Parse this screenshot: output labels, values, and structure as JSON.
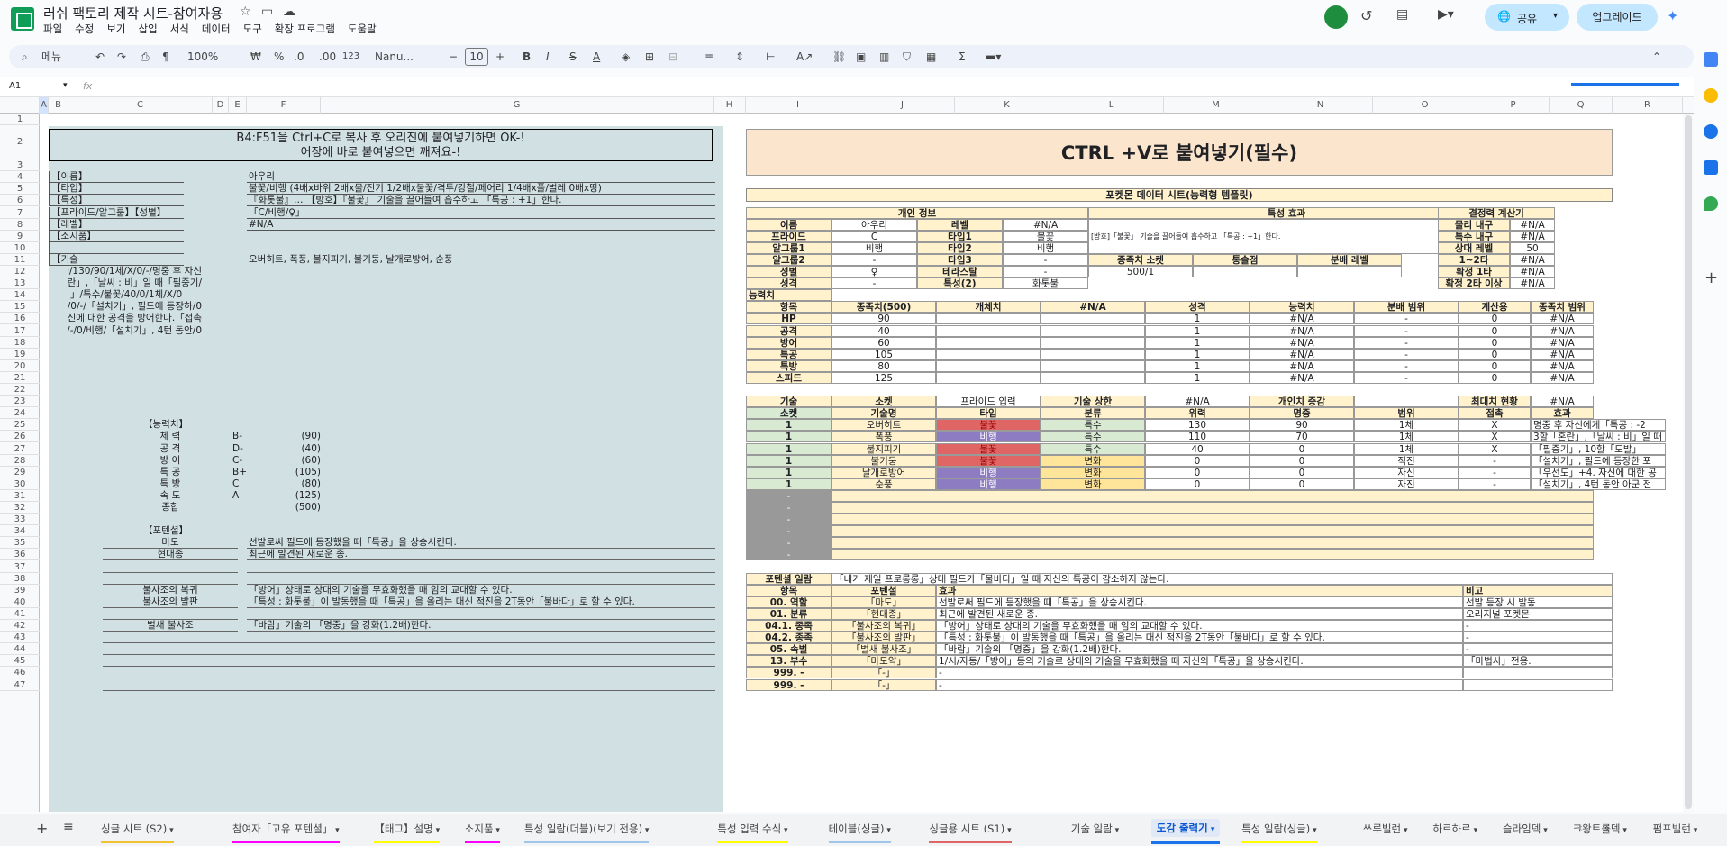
{
  "title": "러쉬 팩토리 제작 시트-참여자용",
  "menu": [
    "파일",
    "수정",
    "보기",
    "삽입",
    "서식",
    "데이터",
    "도구",
    "확장 프로그램",
    "도움말"
  ],
  "share": "공유",
  "upgrade": "업그레이드",
  "toolbar": {
    "search": "메뉴",
    "zoom": "100%",
    "currency": "₩",
    "percent": "%",
    "dec1": ".0",
    "dec2": ".00",
    "num": "123",
    "font": "Nanu...",
    "size": "10"
  },
  "namebox": "A1",
  "fx": "fx",
  "cols": [
    "A",
    "B",
    "C",
    "D",
    "E",
    "F",
    "G",
    "H",
    "I",
    "J",
    "K",
    "L",
    "M",
    "N",
    "O",
    "P",
    "Q",
    "R"
  ],
  "rows": [
    "1",
    "2",
    "3",
    "4",
    "5",
    "6",
    "7",
    "8",
    "9",
    "10",
    "11",
    "12",
    "13",
    "14",
    "15",
    "16",
    "17",
    "18",
    "19",
    "20",
    "21",
    "22",
    "23",
    "24",
    "25",
    "26",
    "27",
    "28",
    "29",
    "30",
    "31",
    "32",
    "33",
    "34",
    "35",
    "36",
    "37",
    "38",
    "39",
    "40",
    "41",
    "42",
    "43",
    "44",
    "45",
    "46",
    "47"
  ],
  "left": {
    "banner1": "B4:F51을 Ctrl+C로 복사 후 오리진에 붙여넣기하면 OK-!",
    "banner2": "어장에 바로 붙여넣으면 깨져요-!",
    "labels": [
      "【이름】",
      "【타입】",
      "【특성】",
      "【프라이드/알그룹】【성별】",
      "【레벨】",
      "【소지품】",
      "",
      "【기술"
    ],
    "name": "아우리",
    "type": "불꽃/비행       (4배x바위   2배x물/전기   1/2배x불꽃/격투/강철/페어리   1/4배x풀/벌레   0배x땅)",
    "trait": "『화톳불』…       【방호】『불꽃』 기술을 끌어들여 흡수하고 「특공 : +1」한다.",
    "pride": "「C/비행/♀」",
    "level": "#N/A",
    "skills_line": "오버히트, 폭풍, 불지피기, 불기둥, 날개로방어, 순풍",
    "skill_frags": [
      "꽃/130/90/1체/X/0/-/명중 후 자신!",
      "/3할「혼란」,「날씨 : 비」일 때「필중기",
      "특수/불꽃/40/0/1체/X/0/「",
      "0/적진/-/0/-/「설치기」, 필드에 등장하",
      "자신에 대한 공격을 방어한다.「접촉",
      "0/자진/-/0/비행/「설치기」, 4턴 동안"
    ],
    "ability_title": "【능력치】",
    "stats": [
      [
        "체   력",
        "B-",
        "(90)"
      ],
      [
        "공   격",
        "D-",
        "(40)"
      ],
      [
        "방   어",
        "C-",
        "(60)"
      ],
      [
        "특   공",
        "B+",
        "(105)"
      ],
      [
        "특   방",
        "C",
        "(80)"
      ],
      [
        "속   도",
        "A",
        "(125)"
      ],
      [
        "종합",
        "",
        "(500)"
      ]
    ],
    "potential_title": "【포텐셜】",
    "potentials": [
      [
        "마도",
        "선발로써 필드에 등장했을 때「특공」을 상승시킨다."
      ],
      [
        "현대종",
        "최근에 발견된 새로운 종."
      ],
      [
        "",
        ""
      ],
      [
        "",
        ""
      ],
      [
        "불사조의 복귀",
        "「방어」상태로 상대의 기술을 무효화했을 때 임의 교대할 수 있다."
      ],
      [
        "불사조의 발판",
        "「특성 : 화톳불」이 발동했을 때「특공」을 올리는 대신 적진을 2T동안「불바다」로 할 수 있다."
      ],
      [
        "",
        ""
      ],
      [
        "벌새 불사조",
        "「바람」기술의 「명중」을 강화(1.2배)한다."
      ]
    ]
  },
  "right": {
    "banner": "CTRL +V로 붙여넣기(필수)",
    "sheet_title": "포켓몬 데이터 시트(능력형 템플릿)",
    "sec_personal": "개인 정보",
    "sec_trait": "특성 효과",
    "sec_decide": "결정력 계산기",
    "info": [
      [
        "이름",
        "아우리",
        "레벨",
        "#N/A"
      ],
      [
        "프라이드",
        "C",
        "타입1",
        "불꽃"
      ],
      [
        "알그룹1",
        "비행",
        "타입2",
        "비행"
      ],
      [
        "알그룹2",
        "-",
        "타입3",
        "-"
      ],
      [
        "성별",
        "♀",
        "테라스탈",
        "-"
      ],
      [
        "성격",
        "-",
        "특성(2)",
        "화톳불"
      ]
    ],
    "trait_effect": "[방호]「불꽃」 기술을 끌어들여 흡수하고 「특공 : +1」한다.",
    "species_hdr": [
      "종족치 소켓",
      "통솔점",
      "분배 레벨"
    ],
    "species_val": "500/1",
    "calc": [
      [
        "물리 내구",
        "#N/A"
      ],
      [
        "특수 내구",
        "#N/A"
      ],
      [
        "상대 레벨",
        "50"
      ],
      [
        "1~2타",
        "#N/A"
      ],
      [
        "확정 1타",
        "#N/A"
      ],
      [
        "확정 2타 이상",
        "#N/A"
      ]
    ],
    "abil_label": "능력치",
    "stat_hdr": [
      "항목",
      "종족치(500)",
      "개체치",
      "#N/A",
      "성격",
      "능력치",
      "분배 범위",
      "계산용",
      "종족치 범위"
    ],
    "stats": [
      [
        "HP",
        "90",
        "1",
        "#N/A",
        "-",
        "0",
        "#N/A"
      ],
      [
        "공격",
        "40",
        "1",
        "#N/A",
        "-",
        "0",
        "#N/A"
      ],
      [
        "방어",
        "60",
        "1",
        "#N/A",
        "-",
        "0",
        "#N/A"
      ],
      [
        "특공",
        "105",
        "1",
        "#N/A",
        "-",
        "0",
        "#N/A"
      ],
      [
        "특방",
        "80",
        "1",
        "#N/A",
        "-",
        "0",
        "#N/A"
      ],
      [
        "스피드",
        "125",
        "1",
        "#N/A",
        "-",
        "0",
        "#N/A"
      ]
    ],
    "skill_top": [
      "기술",
      "소켓",
      "프라이드 입력",
      "기술 상한",
      "#N/A",
      "개인치 증감",
      "",
      "최대치 현황",
      "#N/A"
    ],
    "skill_hdr": [
      "소켓",
      "기술명",
      "타입",
      "분류",
      "위력",
      "명중",
      "범위",
      "접촉",
      "효과"
    ],
    "skills": [
      [
        "1",
        "오버히트",
        "불꽃",
        "특수",
        "130",
        "90",
        "1체",
        "X",
        "명중 후 자신에게「특공 : -2"
      ],
      [
        "1",
        "폭풍",
        "비행",
        "특수",
        "110",
        "70",
        "1체",
        "X",
        "3할「혼란」,「날씨 : 비」일 때"
      ],
      [
        "1",
        "불지피기",
        "불꽃",
        "특수",
        "40",
        "0",
        "1체",
        "X",
        "「필중기」, 10할「도발」"
      ],
      [
        "1",
        "불기둥",
        "불꽃",
        "변화",
        "0",
        "0",
        "적진",
        "-",
        "「설치기」, 필드에 등장한 포"
      ],
      [
        "1",
        "날개로방어",
        "비행",
        "변화",
        "0",
        "0",
        "자신",
        "-",
        "「우선도」+4. 자신에 대한 공"
      ],
      [
        "1",
        "순풍",
        "비행",
        "변화",
        "0",
        "0",
        "자진",
        "-",
        "「설치기」, 4턴 동안 아군 전"
      ]
    ],
    "empty_dash": "-",
    "pot_title": "포텐셜 일람",
    "pot_note": "「내가 제일 프로롱롱」상대 필드가「물바다」일 때 자신의 특공이 감소하지 않는다.",
    "pot_hdr": [
      "항목",
      "포텐셜",
      "효과",
      "비고"
    ],
    "pots": [
      [
        "00. 역할",
        "「마도」",
        "선발로써 필드에 등장했을 때「특공」을 상승시킨다.",
        "선발 등장 시 발동"
      ],
      [
        "01. 분류",
        "「현대종」",
        "최근에 발견된 새로운 종.",
        "오리지널 포켓몬"
      ],
      [
        "04.1. 종족",
        "「불사조의 복귀」",
        "「방어」상태로 상대의 기술을 무효화했을 때 임의 교대할 수 있다.",
        "-"
      ],
      [
        "04.2. 종족",
        "「불사조의 발판」",
        "「특성 : 화톳불」이 발동했을 때「특공」을 올리는 대신 적진을 2T동안「불바다」로 할 수 있다.",
        "-"
      ],
      [
        "05. 속벌",
        "「벌새 불사조」",
        "「바람」기술의 「명중」을 강화(1.2배)한다.",
        "-"
      ],
      [
        "13. 부수",
        "「마도약」",
        "1/시/자동/「방어」등의 기술로 상대의 기술을 무효화했을 때 자신의「특공」을 상승시킨다.",
        "「마법사」전용."
      ],
      [
        "999. -",
        "「-」",
        "-",
        ""
      ],
      [
        "999. -",
        "「-」",
        "-",
        ""
      ]
    ],
    "zero": "0"
  },
  "tabs": [
    "싱글 시트 (S2)",
    "참여자「고유 포텐셜」",
    "【태그】설명",
    "소지품",
    "특성 일람(더블)(보기 전용)",
    "특성 입력 수식",
    "테이블(싱글)",
    "싱글용 시트 (S1)",
    "기술 일람",
    "도감 출력기",
    "특성 일람(싱글)",
    "쓰루빌런",
    "하르하르",
    "슬라임덱",
    "크왕트롤덱",
    "펌프빌런"
  ],
  "active_tab": "도감 출력기"
}
